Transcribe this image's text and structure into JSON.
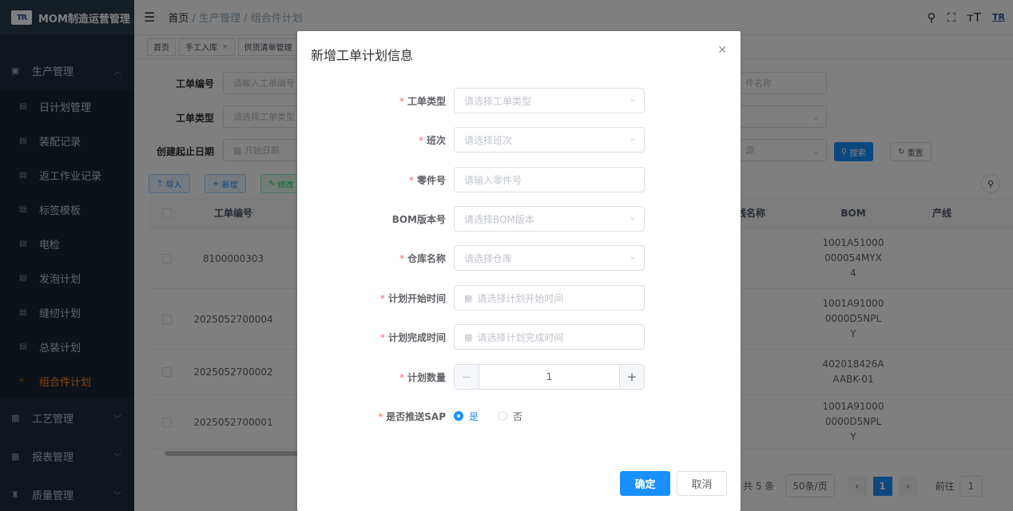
{
  "app": {
    "title": "MOM制造运营管理",
    "logo_text": "TR"
  },
  "sidebar": {
    "top_group": {
      "label": "生产管理"
    },
    "items": [
      {
        "label": "日计划管理"
      },
      {
        "label": "装配记录"
      },
      {
        "label": "返工作业记录"
      },
      {
        "label": "标签模板"
      },
      {
        "label": "电检"
      },
      {
        "label": "发泡计划"
      },
      {
        "label": "缝纫计划"
      },
      {
        "label": "总装计划"
      },
      {
        "label": "组合件计划"
      }
    ],
    "bottom_groups": [
      {
        "label": "工艺管理"
      },
      {
        "label": "报表管理"
      },
      {
        "label": "质量管理"
      }
    ]
  },
  "header": {
    "breadcrumb": [
      "首页",
      "生产管理",
      "组合件计划"
    ]
  },
  "tags": [
    {
      "label": "首页"
    },
    {
      "label": "手工入库"
    },
    {
      "label": "供货清单管理"
    }
  ],
  "filters": {
    "order_no_label": "工单编号",
    "order_no_placeholder": "请输入工单编号",
    "order_type_label": "工单类型",
    "order_type_placeholder": "请选择工单类型",
    "date_label": "创建起止日期",
    "date_start_placeholder": "开始日期",
    "part_name_placeholder": "件名称",
    "source_placeholder": "源",
    "search_label": "搜索",
    "reset_label": "重置"
  },
  "toolbar": {
    "import_label": "导入",
    "add_label": "新增",
    "edit_label": "修改"
  },
  "table": {
    "headers": {
      "order_no": "工单编号",
      "line_name": "线名称",
      "bom": "BOM",
      "prod_line": "产线"
    },
    "rows": [
      {
        "order_no": "8100000303",
        "bom": [
          "1001A51000",
          "000054MYX",
          "4"
        ]
      },
      {
        "order_no": "2025052700004",
        "bom": [
          "1001A91000",
          "0000D5NPL",
          "Y"
        ]
      },
      {
        "order_no": "2025052700002",
        "bom": [
          "402018426A",
          "AABK-01"
        ]
      },
      {
        "order_no": "2025052700001",
        "bom": [
          "1001A91000",
          "0000D5NPL",
          "Y"
        ]
      }
    ]
  },
  "pagination": {
    "total": "共 5 条",
    "page_size": "50条/页",
    "current": "1",
    "goto_label": "前往",
    "goto_value": "1"
  },
  "dialog": {
    "title": "新增工单计划信息",
    "fields": {
      "order_type": {
        "label": "工单类型",
        "placeholder": "请选择工单类型",
        "required": true
      },
      "shift": {
        "label": "班次",
        "placeholder": "请选择班次",
        "required": true
      },
      "part_no": {
        "label": "零件号",
        "placeholder": "请输入零件号",
        "required": true
      },
      "bom_version": {
        "label": "BOM版本号",
        "placeholder": "请选择BOM版本",
        "required": false
      },
      "warehouse": {
        "label": "仓库名称",
        "placeholder": "请选择仓库",
        "required": true
      },
      "plan_start": {
        "label": "计划开始时间",
        "placeholder": "请选择计划开始时间",
        "required": true
      },
      "plan_end": {
        "label": "计划完成时间",
        "placeholder": "请选择计划完成时间",
        "required": true
      },
      "plan_qty": {
        "label": "计划数量",
        "value": "1",
        "required": true
      },
      "push_sap": {
        "label": "是否推送SAP",
        "options": [
          "是",
          "否"
        ],
        "selected": "是",
        "required": true
      }
    },
    "confirm_label": "确定",
    "cancel_label": "取消"
  },
  "colors": {
    "primary": "#1890ff",
    "sidebar_bg": "#1f2d3d",
    "active_menu": "#ff8c1a",
    "required": "#f56c6c"
  }
}
